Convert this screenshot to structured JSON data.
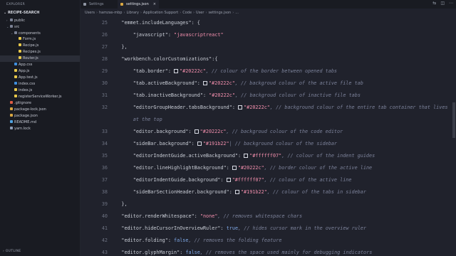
{
  "sidebar": {
    "title": "EXPLORER",
    "project": "RECIPE-SEARCH",
    "outline": "OUTLINE",
    "items": [
      {
        "label": "public",
        "chev": "›",
        "icon": "folder-icon",
        "indent": 0,
        "active": false
      },
      {
        "label": "src",
        "chev": "⌄",
        "icon": "folder-icon",
        "indent": 0,
        "active": false
      },
      {
        "label": "components",
        "chev": "⌄",
        "icon": "folder-icon",
        "indent": 1,
        "active": false
      },
      {
        "label": "Form.js",
        "chev": "",
        "icon": "js-icon",
        "indent": 2,
        "active": false
      },
      {
        "label": "Recipe.js",
        "chev": "",
        "icon": "js-icon",
        "indent": 2,
        "active": false
      },
      {
        "label": "Recipes.js",
        "chev": "",
        "icon": "js-icon",
        "indent": 2,
        "active": false
      },
      {
        "label": "Router.js",
        "chev": "",
        "icon": "js-icon",
        "indent": 2,
        "active": true
      },
      {
        "label": "App.css",
        "chev": "",
        "icon": "css-icon",
        "indent": 1,
        "active": false
      },
      {
        "label": "App.js",
        "chev": "",
        "icon": "js-icon",
        "indent": 1,
        "active": false
      },
      {
        "label": "App.test.js",
        "chev": "",
        "icon": "js-icon",
        "indent": 1,
        "active": false
      },
      {
        "label": "index.css",
        "chev": "",
        "icon": "css-icon",
        "indent": 1,
        "active": false
      },
      {
        "label": "index.js",
        "chev": "",
        "icon": "js-icon",
        "indent": 1,
        "active": false
      },
      {
        "label": "registerServiceWorker.js",
        "chev": "",
        "icon": "js-icon",
        "indent": 1,
        "active": false
      },
      {
        "label": ".gitignore",
        "chev": "",
        "icon": "git-icon",
        "indent": 0,
        "active": false
      },
      {
        "label": "package-lock.json",
        "chev": "",
        "icon": "json-icon",
        "indent": 0,
        "active": false
      },
      {
        "label": "package.json",
        "chev": "",
        "icon": "json-icon",
        "indent": 0,
        "active": false
      },
      {
        "label": "README.md",
        "chev": "",
        "icon": "md-icon",
        "indent": 0,
        "active": false
      },
      {
        "label": "yarn.lock",
        "chev": "",
        "icon": "lock-icon",
        "indent": 0,
        "active": false
      }
    ]
  },
  "tabs": [
    {
      "label": "Settings"
    },
    {
      "label": "settings.json",
      "close": "×"
    }
  ],
  "breadcrumb": [
    "Users",
    "hamzas-mbp",
    "Library",
    "Application Support",
    "Code",
    "User",
    "settings.json",
    "..."
  ],
  "editor": {
    "lines": [
      {
        "n": "25",
        "parts": [
          [
            "k",
            "    \"emmet.includeLanguages\": {"
          ]
        ]
      },
      {
        "n": "26",
        "parts": [
          [
            "k",
            "        \"javascript\": "
          ],
          [
            "s",
            "\"javascriptreact\""
          ]
        ]
      },
      {
        "n": "27",
        "parts": [
          [
            "k",
            "    },"
          ]
        ]
      },
      {
        "n": "28",
        "parts": [
          [
            "k",
            "    \"workbench.colorCustomizations\":{"
          ]
        ]
      },
      {
        "n": "29",
        "parts": [
          [
            "k",
            "        \"tab.border\": "
          ],
          [
            "sw",
            ""
          ],
          [
            "s",
            "\"#20222c\""
          ],
          [
            "c",
            ", // colour of the border between opened tabs"
          ]
        ]
      },
      {
        "n": "30",
        "parts": [
          [
            "k",
            "        \"tab.activeBackground\": "
          ],
          [
            "sw",
            ""
          ],
          [
            "s",
            "\"#20222c\""
          ],
          [
            "c",
            ", // backgroud colour of the active file tab"
          ]
        ]
      },
      {
        "n": "31",
        "parts": [
          [
            "k",
            "        \"tab.inactiveBackground\": "
          ],
          [
            "s",
            "\"#20222c\""
          ],
          [
            "c",
            ", // backgroud colour of inactive file tabs"
          ]
        ]
      },
      {
        "n": "32",
        "parts": [
          [
            "k",
            "        \"editorGroupHeader.tabsBackground\": "
          ],
          [
            "sw",
            ""
          ],
          [
            "s",
            "\"#20222c\""
          ],
          [
            "c",
            ", // background colour of the entire tab container that lives"
          ]
        ]
      },
      {
        "n": "",
        "parts": [
          [
            "c",
            "        at the top"
          ]
        ]
      },
      {
        "n": "33",
        "parts": [
          [
            "k",
            "        \"editor.background\": "
          ],
          [
            "sw",
            ""
          ],
          [
            "s",
            "\"#20222c\""
          ],
          [
            "c",
            ", // backgroud colour of the code editor"
          ]
        ]
      },
      {
        "n": "34",
        "parts": [
          [
            "k",
            "        \"sideBar.background\": "
          ],
          [
            "sw",
            ""
          ],
          [
            "s",
            "\"#191b22\""
          ],
          [
            "c",
            "| // background colour of the sidebar"
          ]
        ]
      },
      {
        "n": "35",
        "parts": [
          [
            "k",
            "        \"editorIndentGuide.activeBackground\": "
          ],
          [
            "sw",
            ""
          ],
          [
            "s",
            "\"#ffffff07\""
          ],
          [
            "c",
            ", // colour of the indent guides"
          ]
        ]
      },
      {
        "n": "36",
        "parts": [
          [
            "k",
            "        \"editor.lineHighlightBackground\": "
          ],
          [
            "sw",
            ""
          ],
          [
            "s",
            "\"#20222c\""
          ],
          [
            "c",
            ", // border colour of the active line"
          ]
        ]
      },
      {
        "n": "37",
        "parts": [
          [
            "k",
            "        \"editorIndentGuide.background\": "
          ],
          [
            "sw",
            ""
          ],
          [
            "s",
            "\"#ffffff07\""
          ],
          [
            "c",
            ", // colour of the active line"
          ]
        ]
      },
      {
        "n": "38",
        "parts": [
          [
            "k",
            "        \"sideBarSectionHeader.background\": "
          ],
          [
            "sw",
            ""
          ],
          [
            "s",
            "\"#191b22\""
          ],
          [
            "c",
            ", // colour of the tabs in sidebar"
          ]
        ]
      },
      {
        "n": "39",
        "parts": [
          [
            "k",
            "    },"
          ]
        ]
      },
      {
        "n": "40",
        "parts": [
          [
            "k",
            "    \"editor.renderWhitespace\": "
          ],
          [
            "s",
            "\"none\""
          ],
          [
            "c",
            ", // removes whitespace chars"
          ]
        ]
      },
      {
        "n": "41",
        "parts": [
          [
            "k",
            "    \"editor.hideCursorInOverviewRuler\": "
          ],
          [
            "kw",
            "true"
          ],
          [
            "c",
            ", // hides cursor mark in the overview ruler"
          ]
        ]
      },
      {
        "n": "42",
        "parts": [
          [
            "k",
            "    \"editor.folding\": "
          ],
          [
            "kw",
            "false"
          ],
          [
            "c",
            ", // removes the folding feature"
          ]
        ]
      },
      {
        "n": "43",
        "parts": [
          [
            "k",
            "    \"editor.glyphMargin\": "
          ],
          [
            "kw",
            "false"
          ],
          [
            "c",
            ", // removes the space used mainly for debugging indicators"
          ]
        ]
      }
    ]
  },
  "colors": {
    "editor_bg": "#20222c",
    "sidebar_bg": "#191b22",
    "string": "#f28fad",
    "comment": "#7c829a",
    "keyword": "#7fa8e6"
  }
}
